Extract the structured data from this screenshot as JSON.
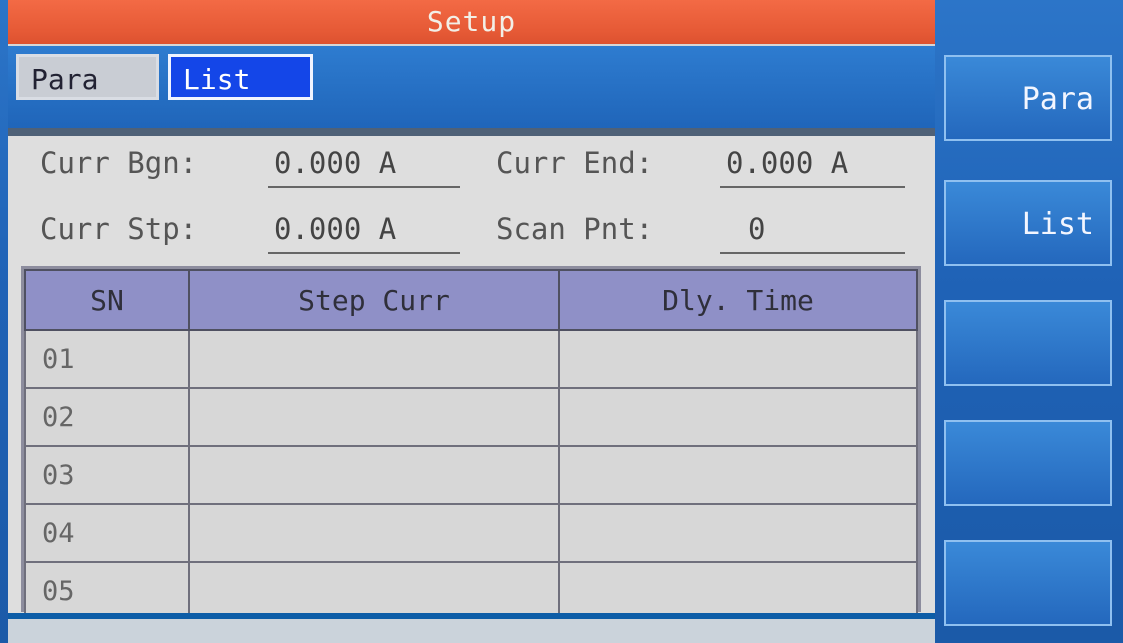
{
  "title": "Setup",
  "tabs": [
    {
      "label": "Para",
      "active": false
    },
    {
      "label": "List",
      "active": true
    }
  ],
  "fields": {
    "curr_bgn": {
      "label": "Curr Bgn:",
      "value": "0.000 A"
    },
    "curr_end": {
      "label": "Curr End:",
      "value": "0.000 A"
    },
    "curr_stp": {
      "label": "Curr Stp:",
      "value": "0.000 A"
    },
    "scan_pnt": {
      "label": "Scan Pnt:",
      "value": "0"
    }
  },
  "table": {
    "headers": [
      "SN",
      "Step Curr",
      "Dly. Time"
    ],
    "rows": [
      {
        "sn": "01",
        "step_curr": "",
        "dly_time": ""
      },
      {
        "sn": "02",
        "step_curr": "",
        "dly_time": ""
      },
      {
        "sn": "03",
        "step_curr": "",
        "dly_time": ""
      },
      {
        "sn": "04",
        "step_curr": "",
        "dly_time": ""
      },
      {
        "sn": "05",
        "step_curr": "",
        "dly_time": ""
      }
    ]
  },
  "softkeys": [
    {
      "label": "Para"
    },
    {
      "label": "List"
    },
    {
      "label": ""
    },
    {
      "label": ""
    },
    {
      "label": ""
    }
  ],
  "colors": {
    "title_bar": "#e85d3a",
    "tab_active": "#1446e8",
    "header_fill": "#8f90c7",
    "panel_bg": "#dedede",
    "softkey_bg": "#2a72c5"
  }
}
